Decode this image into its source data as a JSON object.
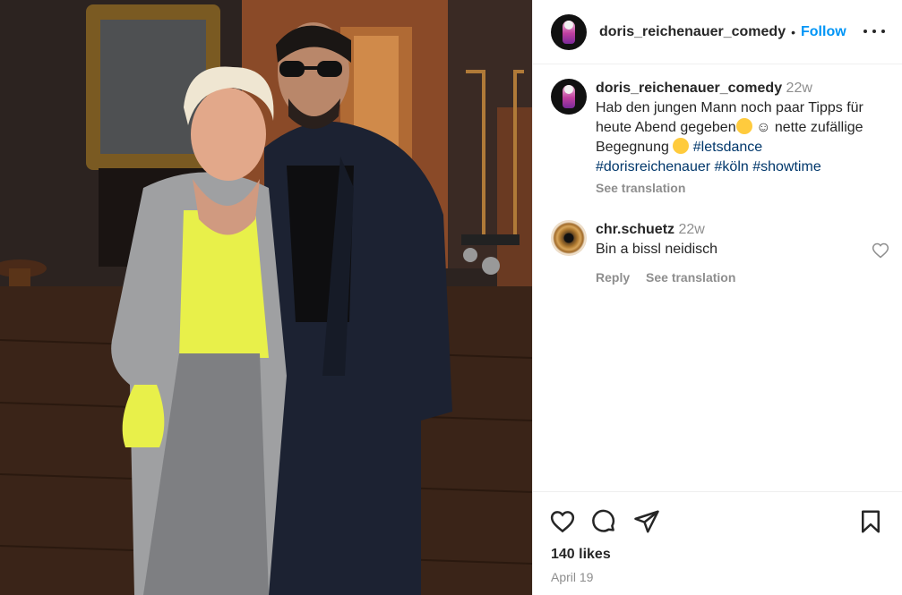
{
  "post": {
    "username": "doris_reichenauer_comedy",
    "follow_label": "Follow",
    "separator": "•"
  },
  "caption": {
    "username": "doris_reichenauer_comedy",
    "age": "22w",
    "text_part1": "Hab den jungen Mann noch paar Tipps für heute Abend gegeben",
    "text_part2": "☺ nette zufällige Begegnung",
    "hashtags": [
      "#letsdance",
      "#dorisreichenauer",
      "#köln",
      "#showtime"
    ],
    "see_translation": "See translation"
  },
  "comments": [
    {
      "username": "chr.schuetz",
      "age": "22w",
      "text": "Bin a bissl neidisch",
      "reply_label": "Reply",
      "see_translation": "See translation"
    }
  ],
  "footer": {
    "likes": "140 likes",
    "date": "April 19"
  },
  "icons": {
    "like": "heart-icon",
    "comment": "comment-icon",
    "share": "share-icon",
    "save": "bookmark-icon",
    "more": "more-options-icon"
  },
  "colors": {
    "accent": "#0095f6",
    "hashtag": "#00376b",
    "muted": "#8e8e8e",
    "text": "#262626"
  }
}
